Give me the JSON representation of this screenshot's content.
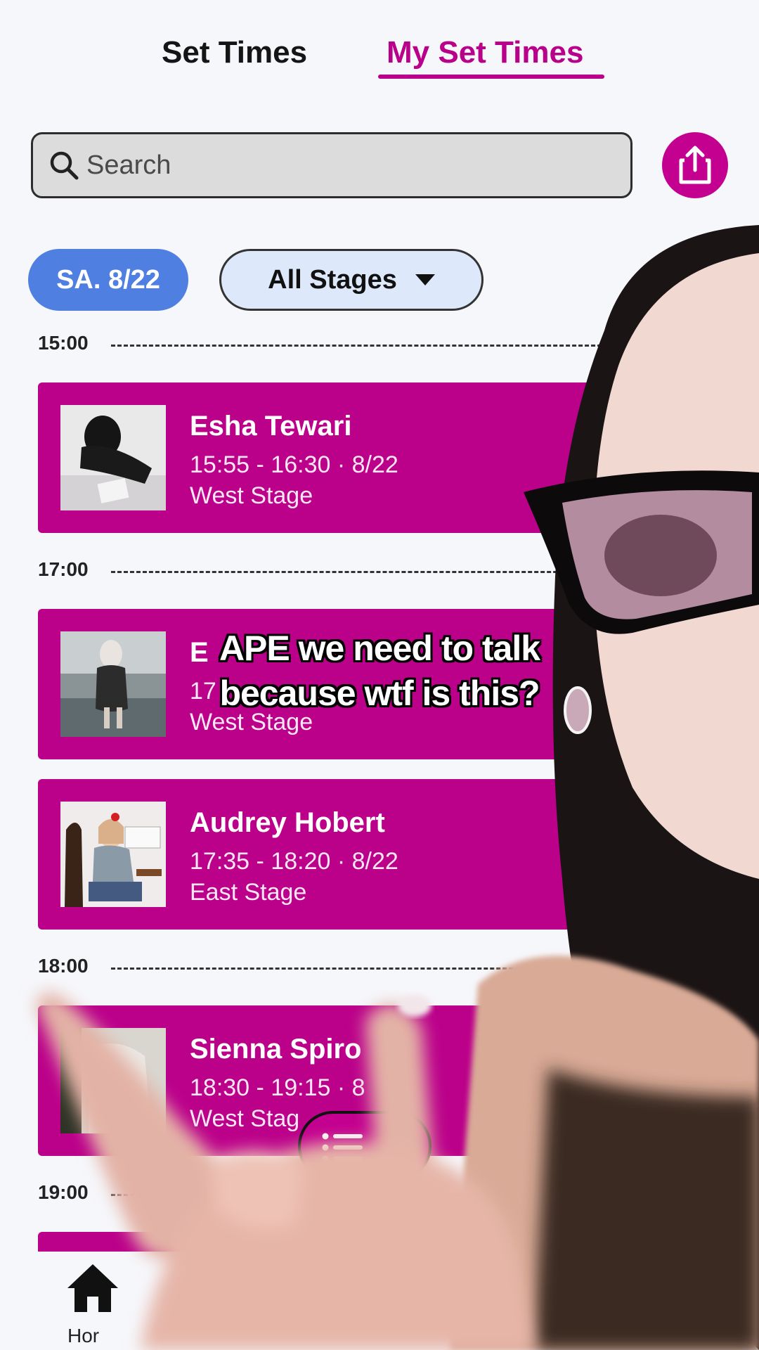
{
  "tabs": {
    "set_times": "Set Times",
    "my_set_times": "My Set Times",
    "active": "My Set Times"
  },
  "search": {
    "placeholder": "Search",
    "value": ""
  },
  "filters": {
    "date": "SA. 8/22",
    "stage": "All Stages"
  },
  "schedule": {
    "hours": [
      "15:00",
      "17:00",
      "18:00",
      "19:00"
    ],
    "sets": [
      {
        "name": "Esha Tewari",
        "time": "15:55 - 16:30 · 8/22",
        "stage": "West Stage"
      },
      {
        "name": "E",
        "time": "17",
        "stage": "West Stage"
      },
      {
        "name": "Audrey Hobert",
        "time": "17:35 - 18:20 · 8/22",
        "stage": "East Stage"
      },
      {
        "name": "Sienna Spiro",
        "time": "18:30 - 19:15 · 8",
        "stage": "West Stag"
      }
    ]
  },
  "bottom_nav": {
    "home_label": "Hor"
  },
  "caption": {
    "line1": "APE we need to talk",
    "line2": "because wtf is this?"
  },
  "colors": {
    "accent": "#bb008a",
    "date_chip": "#4f7fe0",
    "stage_chip": "#dde9fa",
    "background": "#f6f7fb"
  },
  "icons": [
    "search-icon",
    "share-icon",
    "caret-down-icon",
    "list-icon",
    "home-icon"
  ]
}
